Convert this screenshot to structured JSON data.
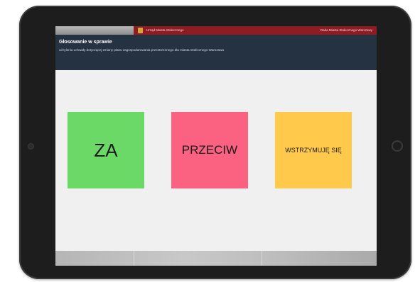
{
  "topbar": {
    "site_name": "Urząd Miasta Stołecznego",
    "right_link": "Rada Miasta Stołecznego Warszawy"
  },
  "header": {
    "title": "Głosowanie w sprawie",
    "subtitle": "uchylenia uchwały dotyczącej zmiany planu zagospodarowania przestrzennego dla miasta stołecznego Warszawa"
  },
  "votes": {
    "za": "ZA",
    "przeciw": "PRZECIW",
    "wstrzymuje": "WSTRZYMUJĘ SIĘ"
  },
  "colors": {
    "za": "#6bd966",
    "przeciw": "#fb6180",
    "wstrzymuje": "#ffc94c",
    "topbar": "#8e1c22",
    "header": "#243241"
  }
}
